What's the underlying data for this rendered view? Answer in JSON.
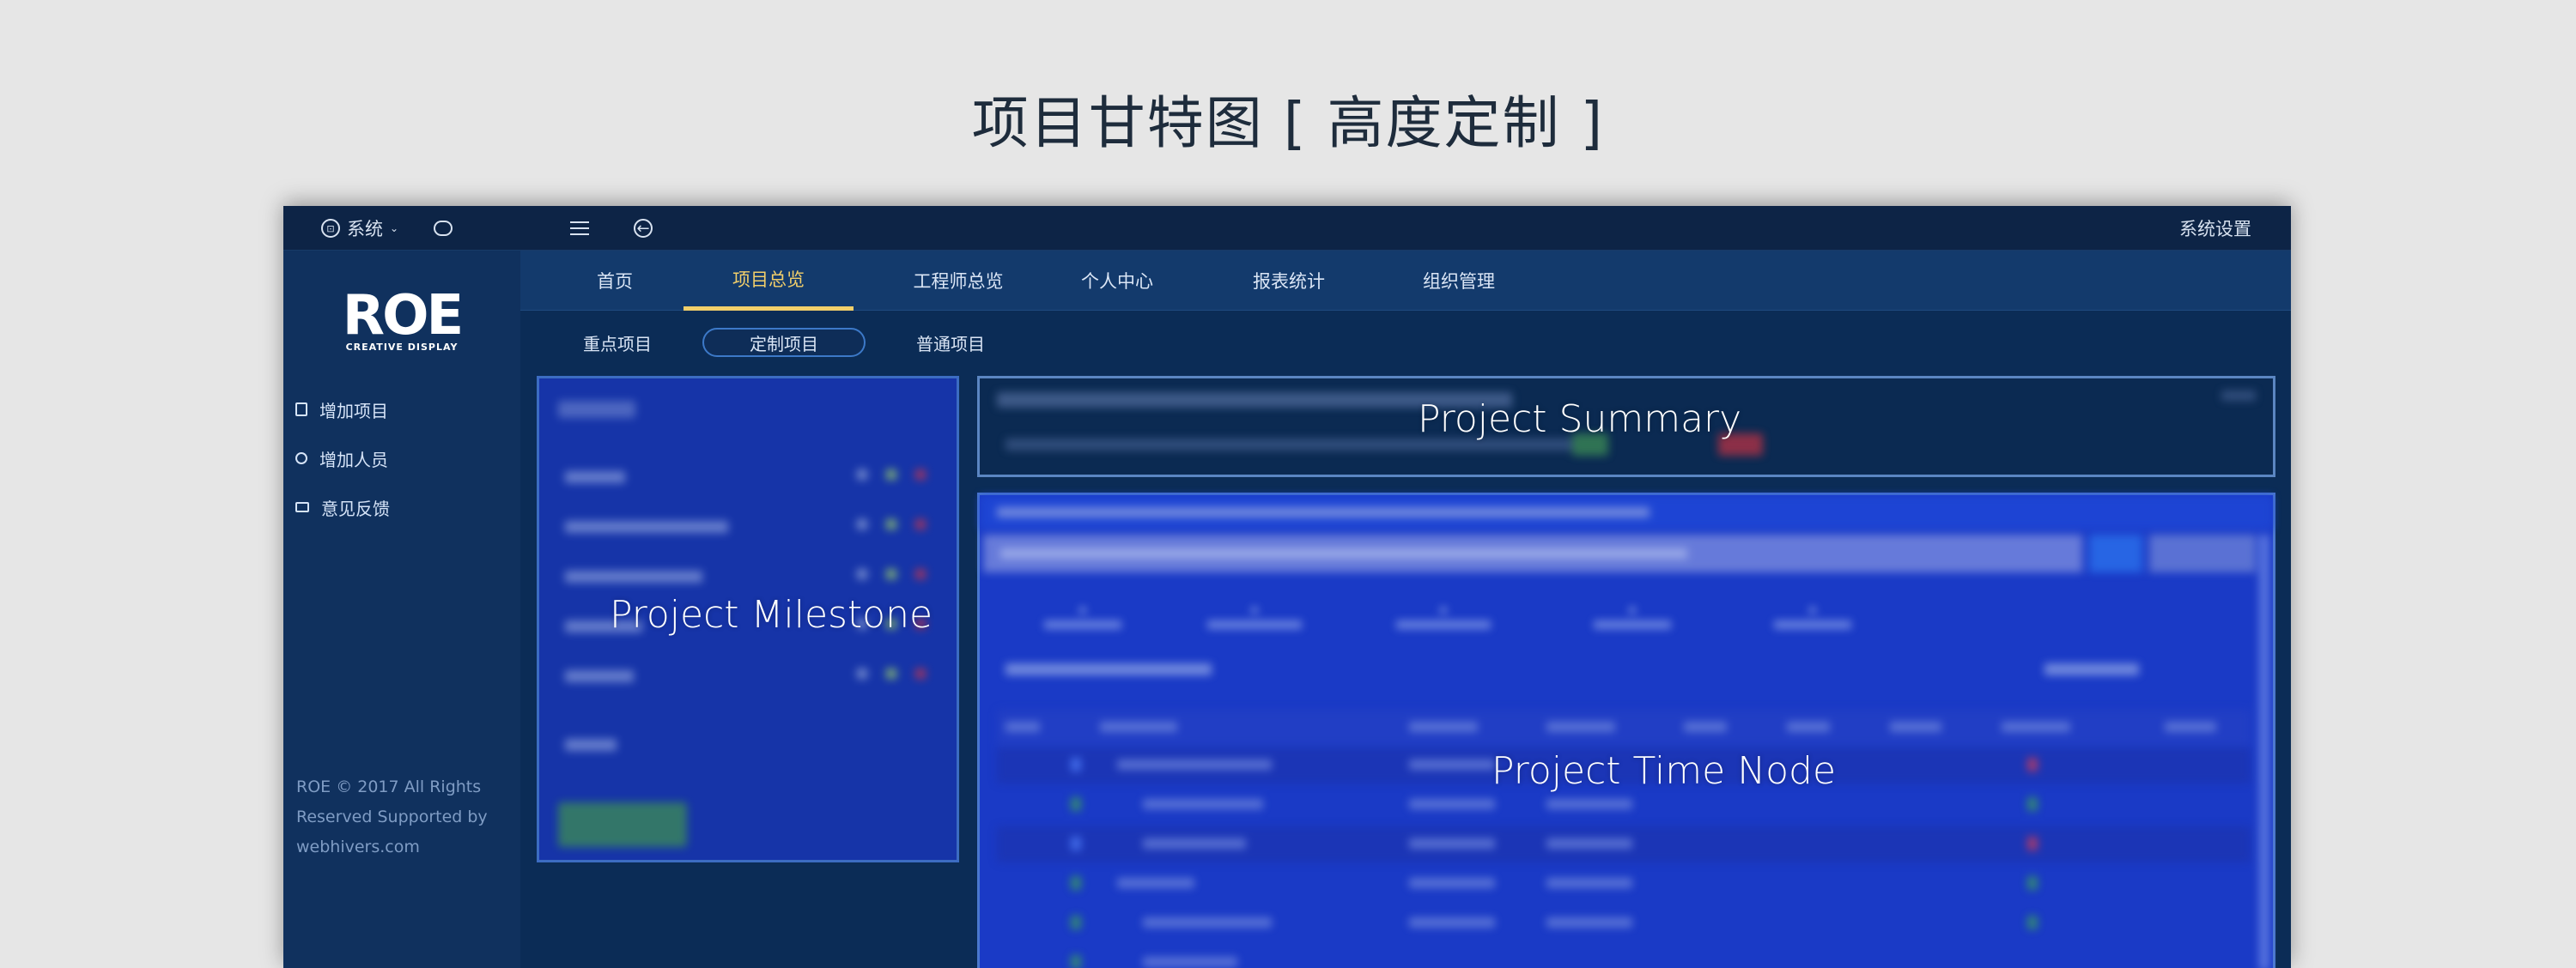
{
  "page_title": "项目甘特图 [ 高度定制 ]",
  "topbar": {
    "system_label": "系统",
    "settings_label": "系统设置"
  },
  "sidebar": {
    "logo_main": "ROE",
    "logo_sub": "CREATIVE DISPLAY",
    "items": [
      {
        "label": "增加项目",
        "icon": "document-add-icon"
      },
      {
        "label": "增加人员",
        "icon": "user-add-icon"
      },
      {
        "label": "意见反馈",
        "icon": "mail-icon"
      }
    ],
    "footer": "ROE © 2017 All Rights Reserved Supported by webhivers.com"
  },
  "nav": {
    "tabs": [
      "首页",
      "项目总览",
      "工程师总览",
      "个人中心",
      "报表统计",
      "组织管理"
    ],
    "active_tab": "项目总览"
  },
  "subnav": {
    "tabs": [
      "重点项目",
      "定制项目",
      "普通项目"
    ],
    "active_tab": "定制项目"
  },
  "panels": {
    "milestone_label": "Project Milestone",
    "summary_label": "Project Summary",
    "timenode_label": "Project Time Node"
  },
  "colors": {
    "accent": "#f2cf6a",
    "nav_bg": "#133a6c",
    "sidebar_bg": "#10315e",
    "panel_blue": "#1a3ac6"
  }
}
